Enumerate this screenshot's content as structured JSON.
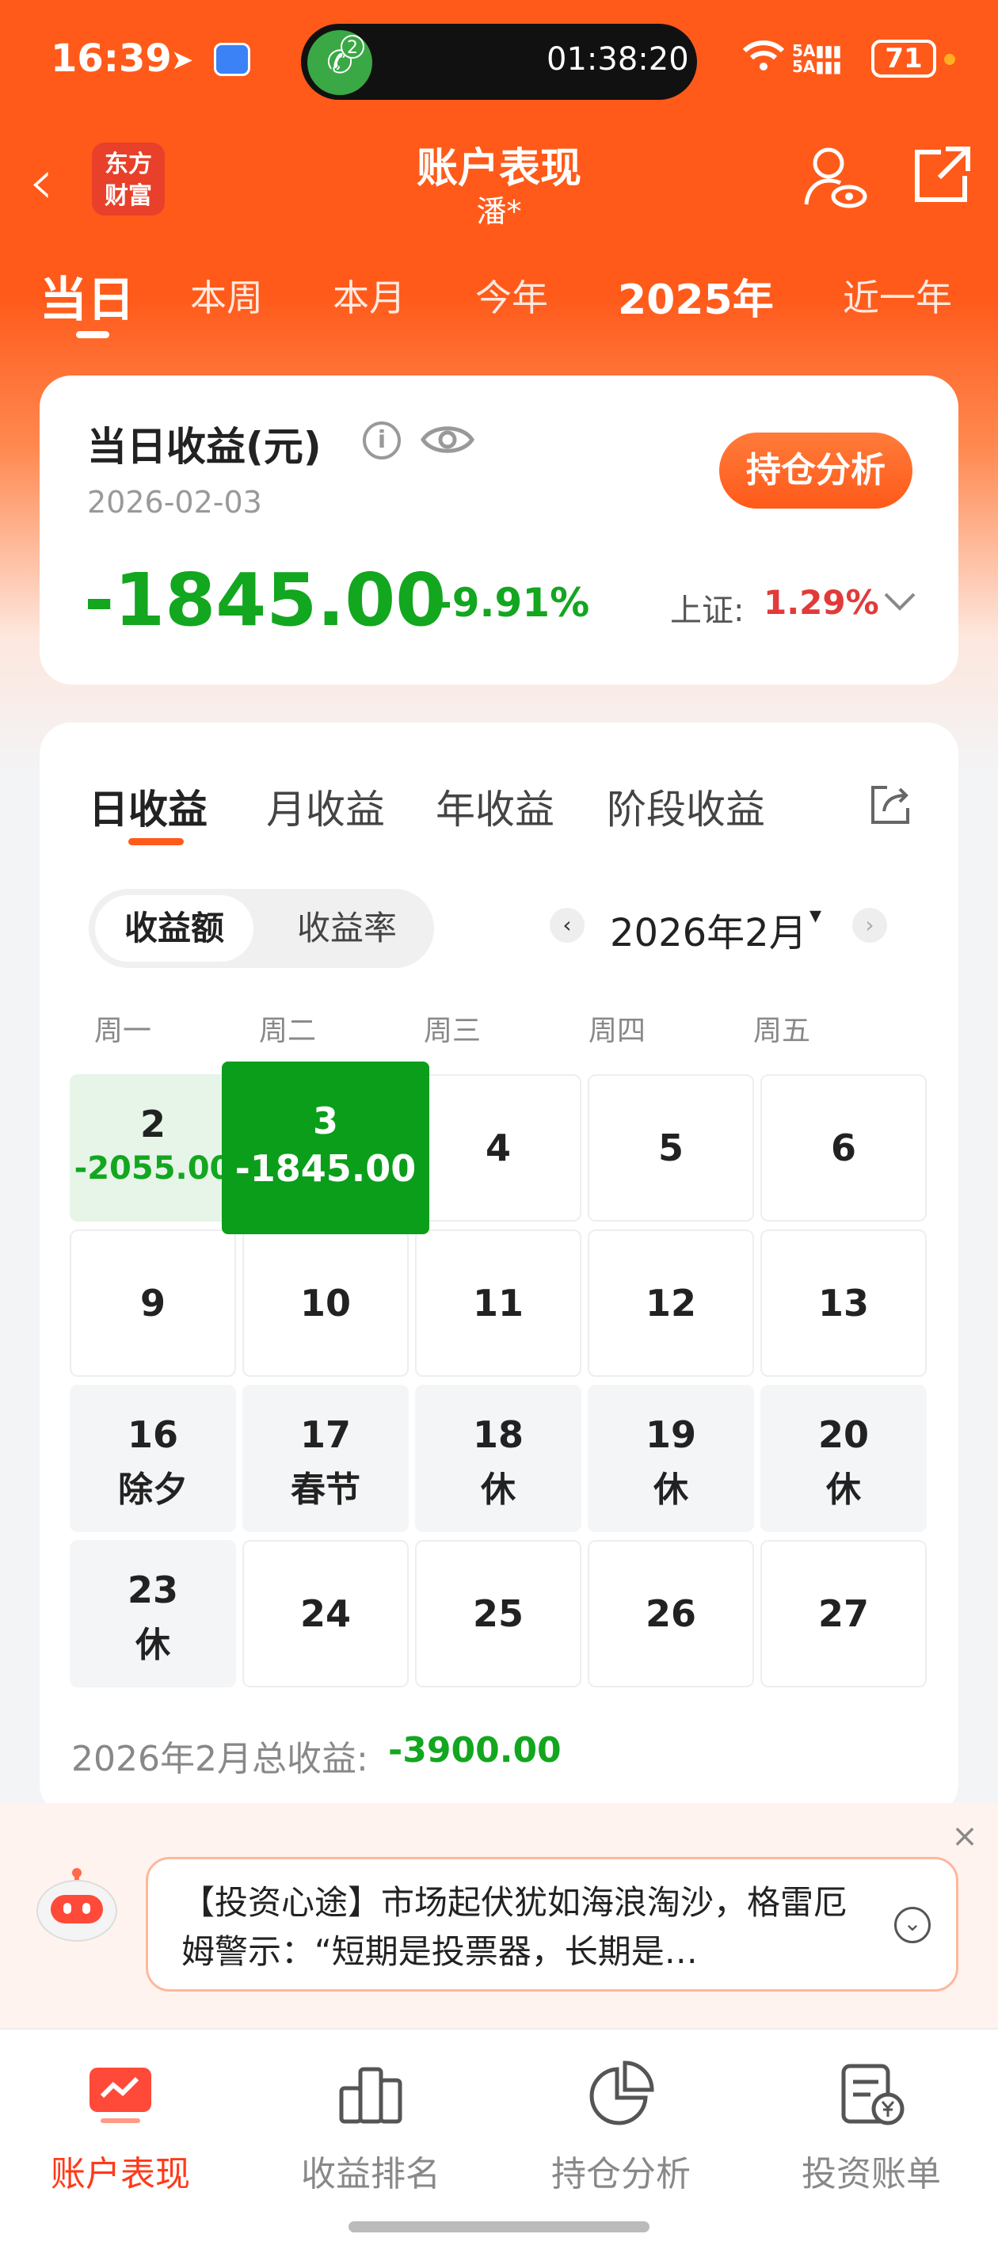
{
  "status_bar": {
    "time": "16:39",
    "call_badge": "2",
    "call_timer": "01:38:20",
    "battery": "71",
    "signal_top": "5A",
    "signal_bottom": "5A"
  },
  "header": {
    "logo_line1": "东方",
    "logo_line2": "财富",
    "title": "账户表现",
    "subtitle": "潘*"
  },
  "period_tabs": [
    {
      "label": "当日",
      "active": true
    },
    {
      "label": "本周"
    },
    {
      "label": "本月"
    },
    {
      "label": "今年"
    },
    {
      "label": "2025年"
    },
    {
      "label": "近一年"
    }
  ],
  "summary": {
    "title": "当日收益(元)",
    "info_glyph": "i",
    "date": "2026-02-03",
    "analysis_button": "持仓分析",
    "amount": "-1845.00",
    "percent": "-9.91%",
    "index_label": "上证:",
    "index_value": "1.29%"
  },
  "returns": {
    "tabs": [
      {
        "label": "日收益",
        "active": true
      },
      {
        "label": "月收益"
      },
      {
        "label": "年收益"
      },
      {
        "label": "阶段收益"
      }
    ],
    "segment": [
      {
        "label": "收益额",
        "active": true
      },
      {
        "label": "收益率"
      }
    ],
    "month_prev": "‹",
    "month": "2026年2月",
    "month_caret": "▾",
    "month_next": "›",
    "weekdays": [
      "周一",
      "周二",
      "周三",
      "周四",
      "周五"
    ],
    "calendar": [
      [
        {
          "day": "2",
          "sub": "-2055.00",
          "style": "lightgreen"
        },
        {
          "day": "3",
          "sub": "-1845.00",
          "style": "selected"
        },
        {
          "day": "4"
        },
        {
          "day": "5"
        },
        {
          "day": "6"
        }
      ],
      [
        {
          "day": "9"
        },
        {
          "day": "10"
        },
        {
          "day": "11"
        },
        {
          "day": "12"
        },
        {
          "day": "13"
        }
      ],
      [
        {
          "day": "16",
          "sub": "除夕",
          "style": "holiday"
        },
        {
          "day": "17",
          "sub": "春节",
          "style": "holiday"
        },
        {
          "day": "18",
          "sub": "休",
          "style": "holiday"
        },
        {
          "day": "19",
          "sub": "休",
          "style": "holiday"
        },
        {
          "day": "20",
          "sub": "休",
          "style": "holiday"
        }
      ],
      [
        {
          "day": "23",
          "sub": "休",
          "style": "holiday"
        },
        {
          "day": "24"
        },
        {
          "day": "25"
        },
        {
          "day": "26"
        },
        {
          "day": "27"
        }
      ]
    ],
    "month_total_label": "2026年2月总收益:",
    "month_total_value": "-3900.00"
  },
  "tip": {
    "close": "×",
    "text": "【投资心途】市场起伏犹如海浪淘沙，格雷厄姆警示：“短期是投票器，长期是…",
    "expand": "⌄"
  },
  "bottom_nav": [
    {
      "label": "账户表现",
      "icon": "account-performance-icon",
      "active": true
    },
    {
      "label": "收益排名",
      "icon": "ranking-icon"
    },
    {
      "label": "持仓分析",
      "icon": "pie-chart-icon"
    },
    {
      "label": "投资账单",
      "icon": "bill-icon"
    }
  ],
  "colors": {
    "brand": "#ff5a1a",
    "loss_green": "#13a61f",
    "gain_red": "#e23a3a"
  }
}
